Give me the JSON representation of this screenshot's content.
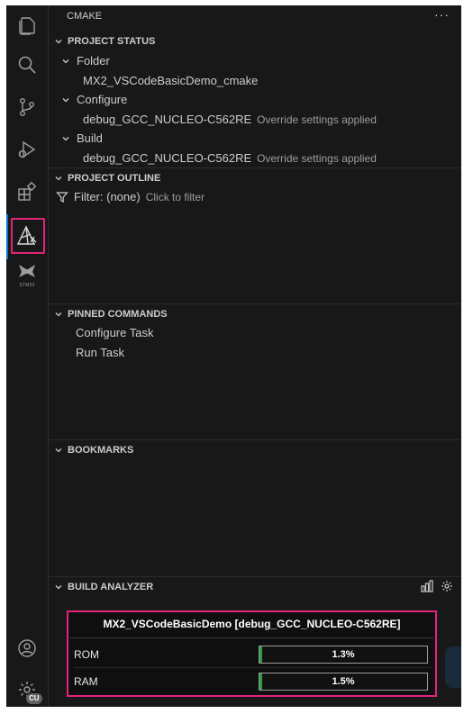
{
  "panel": {
    "title": "CMAKE",
    "more": "···"
  },
  "sections": {
    "project_status": {
      "header": "PROJECT STATUS",
      "folder_label": "Folder",
      "folder_value": "MX2_VSCodeBasicDemo_cmake",
      "configure_label": "Configure",
      "configure_value": "debug_GCC_NUCLEO-C562RE",
      "configure_desc": "Override settings applied",
      "build_label": "Build",
      "build_value": "debug_GCC_NUCLEO-C562RE",
      "build_desc": "Override settings applied"
    },
    "project_outline": {
      "header": "PROJECT OUTLINE",
      "filter_label": "Filter: (none)",
      "filter_hint": "Click to filter"
    },
    "pinned_commands": {
      "header": "PINNED COMMANDS",
      "items": [
        "Configure Task",
        "Run Task"
      ]
    },
    "bookmarks": {
      "header": "BOOKMARKS"
    },
    "build_analyzer": {
      "header": "BUILD ANALYZER",
      "project": "MX2_VSCodeBasicDemo [debug_GCC_NUCLEO-C562RE]",
      "memory": [
        {
          "name": "ROM",
          "usage": "1.3%",
          "fraction": 0.013
        },
        {
          "name": "RAM",
          "usage": "1.5%",
          "fraction": 0.015
        }
      ]
    }
  },
  "activity_bar": {
    "icons": [
      "explorer-icon",
      "search-icon",
      "source-control-icon",
      "run-debug-icon",
      "extensions-icon",
      "cmake-icon",
      "stm32-icon",
      "account-icon",
      "manage-icon"
    ],
    "stm32_label": "STM32",
    "manage_badge": "CU"
  },
  "colors": {
    "accent": "#0078d4",
    "highlight": "#e3257a",
    "bar_fill": "#2ea043"
  }
}
